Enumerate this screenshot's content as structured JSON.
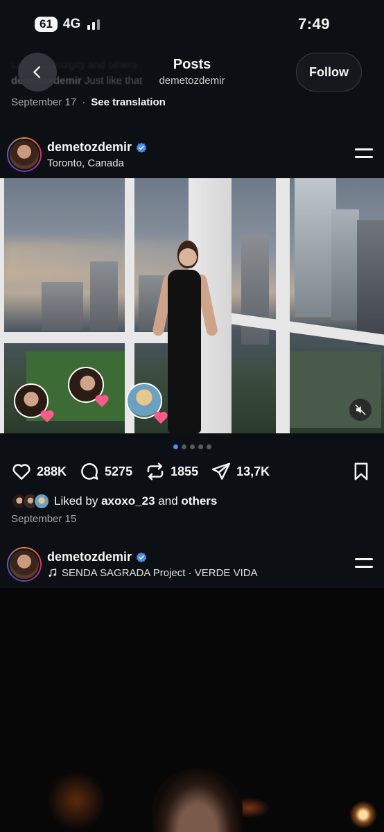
{
  "status_bar": {
    "battery": "61",
    "network": "4G",
    "time": "7:49"
  },
  "header": {
    "title": "Posts",
    "subtitle": "demetozdemir",
    "follow_label": "Follow"
  },
  "previous_post": {
    "liked_by": "Liked by yazgity and others",
    "caption_user": "demetozdemir",
    "caption_text": "Just like that",
    "date": "September 17",
    "separator": "·",
    "see_translation": "See translation"
  },
  "post": {
    "username": "demetozdemir",
    "location": "Toronto, Canada",
    "likes": "288K",
    "comments": "5275",
    "reposts": "1855",
    "shares": "13,7K",
    "liked_by_prefix": "Liked by",
    "liked_by_user": "axoxo_23",
    "liked_by_and": "and",
    "liked_by_others": "others",
    "date": "September 15",
    "carousel_count": 5,
    "carousel_active_index": 0
  },
  "next_post": {
    "username": "demetozdemir",
    "audio": "SENDA SAGRADA Project · VERDE VIDA"
  },
  "colors": {
    "background": "#0c1014",
    "text": "#f5f5f5",
    "secondary_text": "#a8a8a8",
    "verified_blue": "#4d8cf5",
    "active_dot": "#4d8cf5",
    "heart_pink": "#ff5a8a"
  },
  "icons": [
    "back-arrow-icon",
    "menu-icon",
    "verified-icon",
    "heart-icon",
    "comment-icon",
    "repost-icon",
    "share-icon",
    "bookmark-icon",
    "mute-icon",
    "music-note-icon"
  ]
}
